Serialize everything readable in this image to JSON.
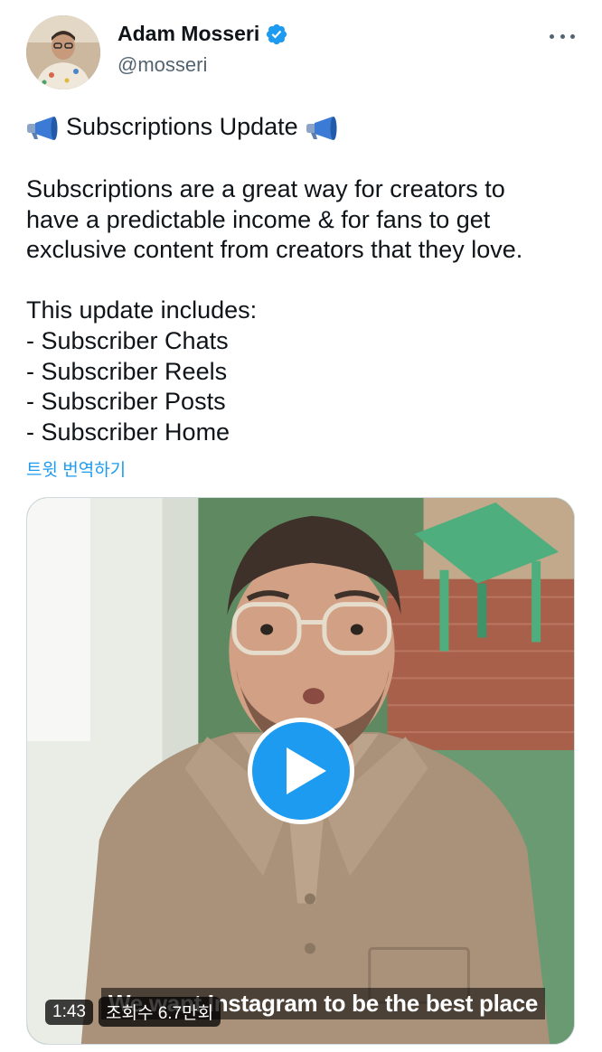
{
  "author": {
    "display_name": "Adam Mosseri",
    "handle": "@mosseri",
    "verified": true,
    "verified_color": "#1d9bf0"
  },
  "menu": {
    "more_icon": "more-horizontal-icon"
  },
  "tweet": {
    "headline": "Subscriptions Update",
    "headline_icon": "megaphone-icon",
    "paragraph_lines": [
      "Subscriptions are a great way for creators to",
      "have a predictable income & for fans to get",
      "exclusive content from creators that they love."
    ],
    "list_intro": "This update includes:",
    "list_items": [
      "- Subscriber Chats",
      "- Subscriber Reels",
      "- Subscriber Posts",
      "- Subscriber Home"
    ],
    "translate_link": "트윗 번역하기"
  },
  "video": {
    "duration": "1:43",
    "views": "조회수 6.7만회",
    "caption": "We want Instagram to be the best place",
    "play_icon": "play-icon"
  },
  "colors": {
    "accent": "#1d9bf0",
    "text_primary": "#0f1419",
    "text_secondary": "#536471"
  }
}
